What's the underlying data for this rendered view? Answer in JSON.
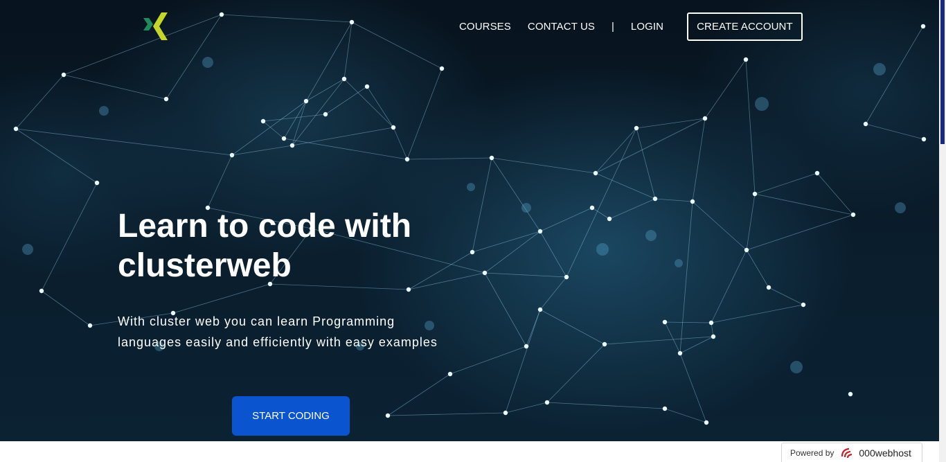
{
  "nav": {
    "courses": "COURSES",
    "contact": "CONTACT US",
    "separator": "|",
    "login": "LOGIN",
    "create_account": "CREATE ACCOUNT"
  },
  "hero": {
    "headline": "Learn to code with clusterweb",
    "subtext": "With cluster web you can learn Programming languages easily and efficiently with easy examples",
    "cta": "START CODING"
  },
  "badge": {
    "powered_by": "Powered by",
    "host_name": "000webhost"
  },
  "icons": {
    "logo": "x-chevron-logo-icon",
    "host": "000webhost-logo-icon"
  },
  "colors": {
    "cta": "#0a55cf",
    "logo_green": "#1f8a5a",
    "logo_yellow": "#c5d62a",
    "host_red": "#c0262d"
  }
}
